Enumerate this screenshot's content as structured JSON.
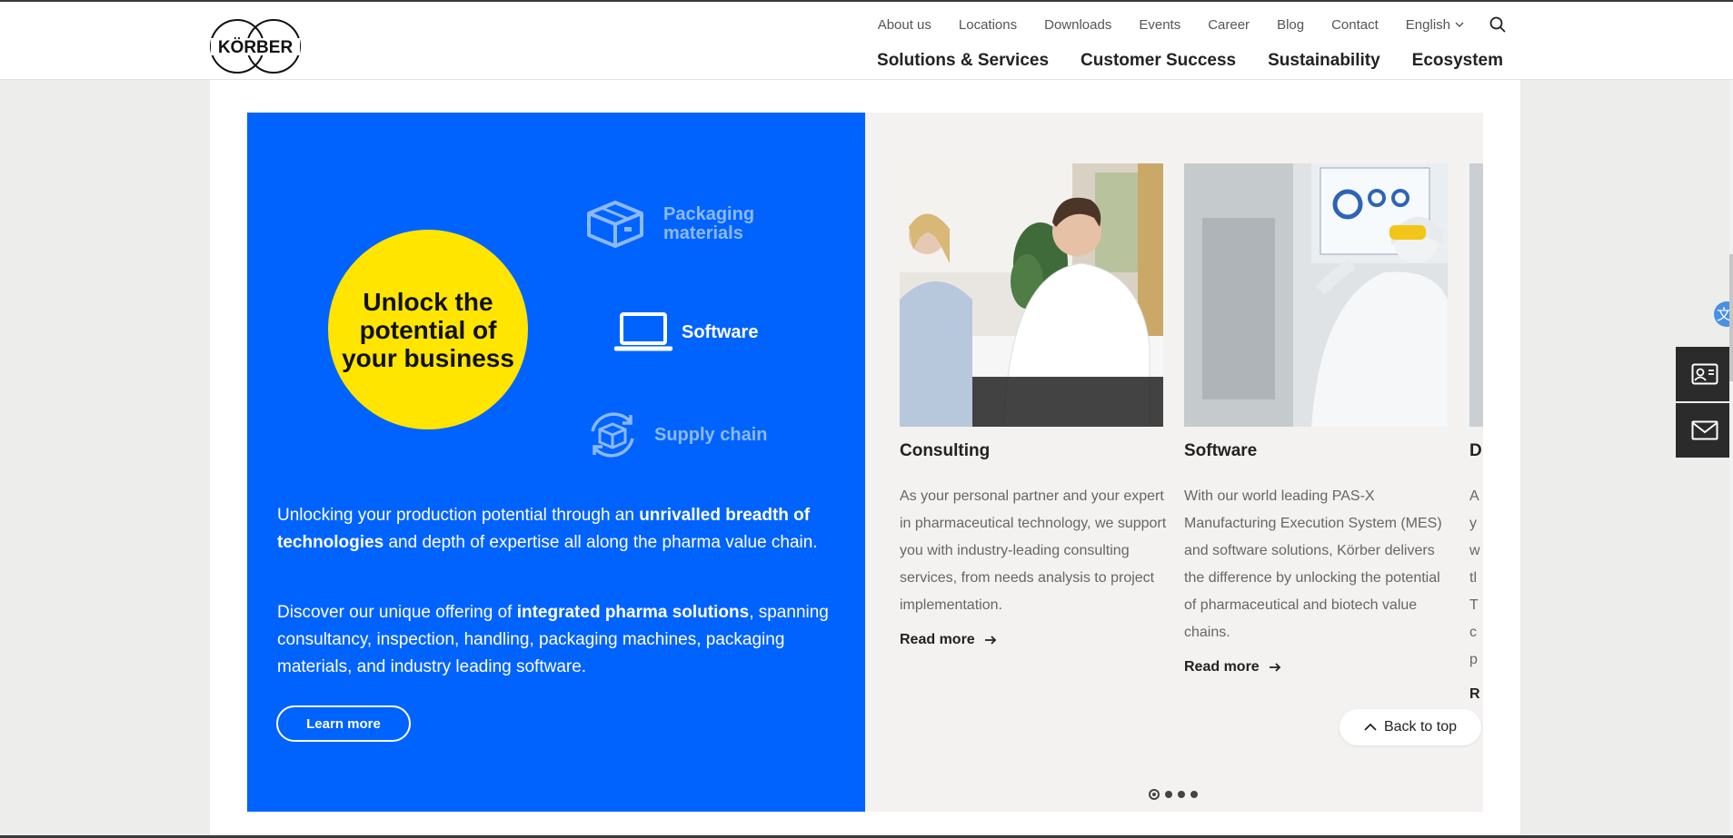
{
  "header": {
    "logo_text": "KÖRBER",
    "utility_nav": [
      "About us",
      "Locations",
      "Downloads",
      "Events",
      "Career",
      "Blog",
      "Contact"
    ],
    "language": "English",
    "main_nav": [
      "Solutions & Services",
      "Customer Success",
      "Sustainability",
      "Ecosystem"
    ]
  },
  "hero": {
    "circle_text": "Unlock the potential of your business",
    "products": [
      {
        "label": "Packaging materials",
        "icon": "package-box-icon"
      },
      {
        "label": "Software",
        "icon": "laptop-icon"
      },
      {
        "label": "Supply chain",
        "icon": "supply-chain-cycle-icon"
      }
    ],
    "p1_a": "Unlocking your production potential through an ",
    "p1_b": "unrivalled breadth of technologies",
    "p1_c": " and depth of expertise all along the pharma value chain.",
    "p2_a": "Discover our unique offering of ",
    "p2_b": "integrated pharma solutions",
    "p2_c": ", spanning consultancy, inspection, handling, packaging machines, packaging materials, and industry leading software.",
    "cta_label": "Learn more"
  },
  "cards": [
    {
      "title": "Consulting",
      "text": "As your personal partner and your expert in pharmaceutical technology, we support you with industry-leading consulting services, from needs analysis to project implementation.",
      "link": "Read more"
    },
    {
      "title": "Software",
      "text": "With our world leading PAS-X Manufacturing Execution System (MES) and software solutions, Körber delivers the difference by unlocking the potential of pharmaceutical and biotech value chains.",
      "link": "Read more"
    }
  ],
  "peek_card": {
    "title_letter": "D",
    "text_letters": [
      "A",
      "y",
      "w",
      "tl",
      "T",
      "c",
      "p"
    ],
    "link_letter": "R"
  },
  "carousel": {
    "pages": 4,
    "active": 1
  },
  "back_to_top": "Back to top",
  "colors": {
    "brand_blue": "#0063fe",
    "accent_yellow": "#ffe500",
    "panel_grey": "#f3f2f0"
  }
}
